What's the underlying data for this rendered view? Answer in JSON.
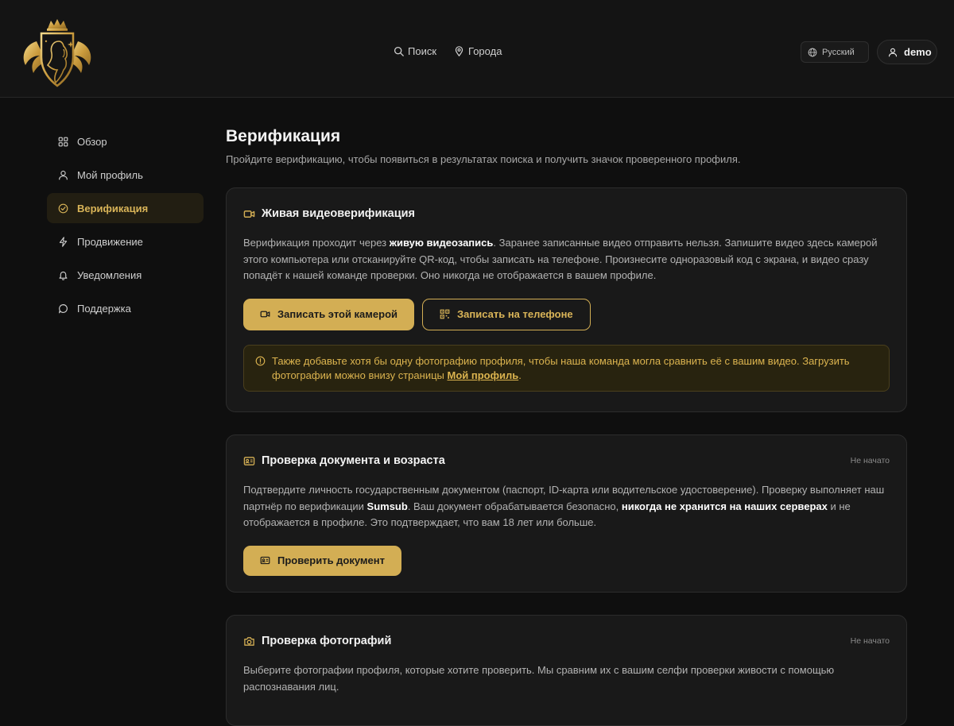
{
  "header": {
    "nav": [
      {
        "label": "Поиск",
        "icon": "search-icon"
      },
      {
        "label": "Города",
        "icon": "map-pin-icon"
      }
    ],
    "language": "Русский",
    "username": "demo"
  },
  "sidebar": {
    "items": [
      {
        "label": "Обзор",
        "icon": "grid-icon"
      },
      {
        "label": "Мой профиль",
        "icon": "user-icon"
      },
      {
        "label": "Верификация",
        "icon": "check-circle-icon",
        "active": true
      },
      {
        "label": "Продвижение",
        "icon": "lightning-icon"
      },
      {
        "label": "Уведомления",
        "icon": "bell-icon"
      },
      {
        "label": "Поддержка",
        "icon": "chat-icon"
      }
    ]
  },
  "page": {
    "title": "Верификация",
    "subtitle": "Пройдите верификацию, чтобы появиться в результатах поиска и получить значок проверенного профиля."
  },
  "cards": {
    "video": {
      "title": "Живая видеоверификация",
      "text_1": "Верификация проходит через ",
      "text_bold": "живую видеозапись",
      "text_2": ". Заранее записанные видео отправить нельзя. Запишите видео здесь камерой этого компьютера или отсканируйте QR-код, чтобы записать на телефоне. Произнесите одноразовый код с экрана, и видео сразу попадёт к нашей команде проверки. Оно никогда не отображается в вашем профиле.",
      "btn_camera": "Записать этой камерой",
      "btn_phone": "Записать на телефоне",
      "notice_text": "Также добавьте хотя бы одну фотографию профиля, чтобы наша команда могла сравнить её с вашим видео. Загрузить фотографии можно внизу страницы ",
      "notice_link": "Мой профиль",
      "notice_end": "."
    },
    "document": {
      "title": "Проверка документа и возраста",
      "status": "Не начато",
      "text_1": "Подтвердите личность государственным документом (паспорт, ID-карта или водительское удостоверение). Проверку выполняет наш партнёр по верификации ",
      "text_bold_1": "Sumsub",
      "text_2": ". Ваш документ обрабатывается безопасно, ",
      "text_bold_2": "никогда не хранится на наших серверах",
      "text_3": " и не отображается в профиле. Это подтверждает, что вам 18 лет или больше.",
      "btn": "Проверить документ"
    },
    "photos": {
      "title": "Проверка фотографий",
      "status": "Не начато",
      "text": "Выберите фотографии профиля, которые хотите проверить. Мы сравним их с вашим селфи проверки живости с помощью распознавания лиц."
    }
  },
  "colors": {
    "accent": "#d3ae54",
    "background": "#0f0f0f",
    "card": "#191919"
  }
}
